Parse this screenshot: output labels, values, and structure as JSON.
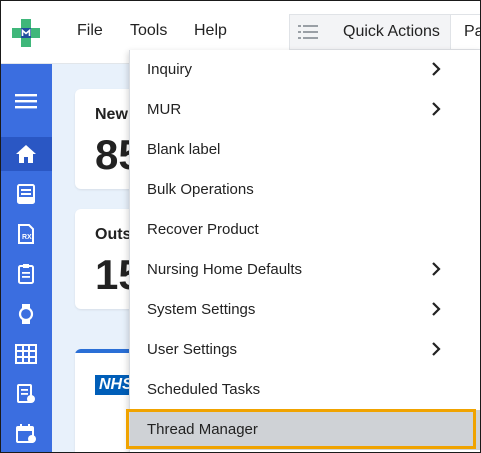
{
  "menubar": {
    "file": "File",
    "tools": "Tools",
    "help": "Help"
  },
  "toolbar": {
    "quick_actions": "Quick Actions",
    "next_tab_partial": "Pa"
  },
  "dashboard": {
    "card1": {
      "title_partial": "New",
      "value_partial": "85"
    },
    "card2": {
      "title_partial": "Outs",
      "value_partial": "15"
    },
    "card3": {
      "badge": "NHS"
    }
  },
  "tools_menu": {
    "items": [
      {
        "label": "Inquiry",
        "submenu": true
      },
      {
        "label": "MUR",
        "submenu": true
      },
      {
        "label": "Blank label",
        "submenu": false
      },
      {
        "label": "Bulk Operations",
        "submenu": false
      },
      {
        "label": "Recover Product",
        "submenu": false
      },
      {
        "label": "Nursing Home Defaults",
        "submenu": true
      },
      {
        "label": "System Settings",
        "submenu": true
      },
      {
        "label": "User Settings",
        "submenu": true
      },
      {
        "label": "Scheduled Tasks",
        "submenu": false
      },
      {
        "label": "Thread Manager",
        "submenu": false,
        "highlighted": true
      }
    ]
  },
  "colors": {
    "sidenav": "#3b6ee0",
    "sidenav_active": "#2a57c4",
    "highlight_border": "#f0a300",
    "highlight_fill": "#cfd2d6",
    "logo_green": "#3fb77a",
    "logo_blue": "#1f4f9e"
  },
  "icons": [
    "app-logo-icon",
    "quick-actions-list-icon",
    "hamburger-icon",
    "home-icon",
    "inbox-icon",
    "prescription-icon",
    "clipboard-icon",
    "watch-icon",
    "grid-icon",
    "document-settings-icon",
    "calendar-icon",
    "chevron-right-icon"
  ]
}
